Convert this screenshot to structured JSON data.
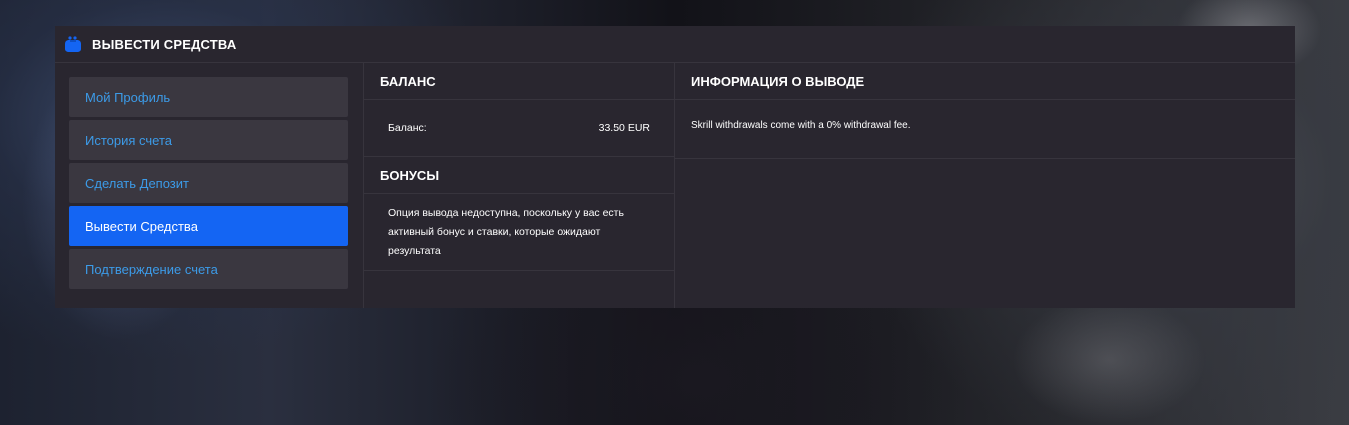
{
  "header": {
    "icon": "wallet-icon",
    "title": "ВЫВЕСТИ СРЕДСТВА"
  },
  "sidebar": {
    "items": [
      {
        "label": "Мой Профиль",
        "active": false
      },
      {
        "label": "История счета",
        "active": false
      },
      {
        "label": "Сделать Депозит",
        "active": false
      },
      {
        "label": "Вывести Средства",
        "active": true
      },
      {
        "label": "Подтверждение счета",
        "active": false
      }
    ]
  },
  "balance": {
    "title": "БАЛАНС",
    "label": "Баланс:",
    "value": "33.50 EUR"
  },
  "bonuses": {
    "title": "БОНУСЫ",
    "message": "Опция вывода недоступна, поскольку у вас есть активный бонус и ставки, которые ожидают результата"
  },
  "withdrawal_info": {
    "title": "ИНФОРМАЦИЯ О ВЫВОДЕ",
    "text": "Skrill withdrawals come with a 0% withdrawal fee."
  },
  "colors": {
    "accent": "#1465f3",
    "link": "#3c9be8",
    "panel_bg": "#29262f",
    "nav_bg": "#3a3740"
  }
}
